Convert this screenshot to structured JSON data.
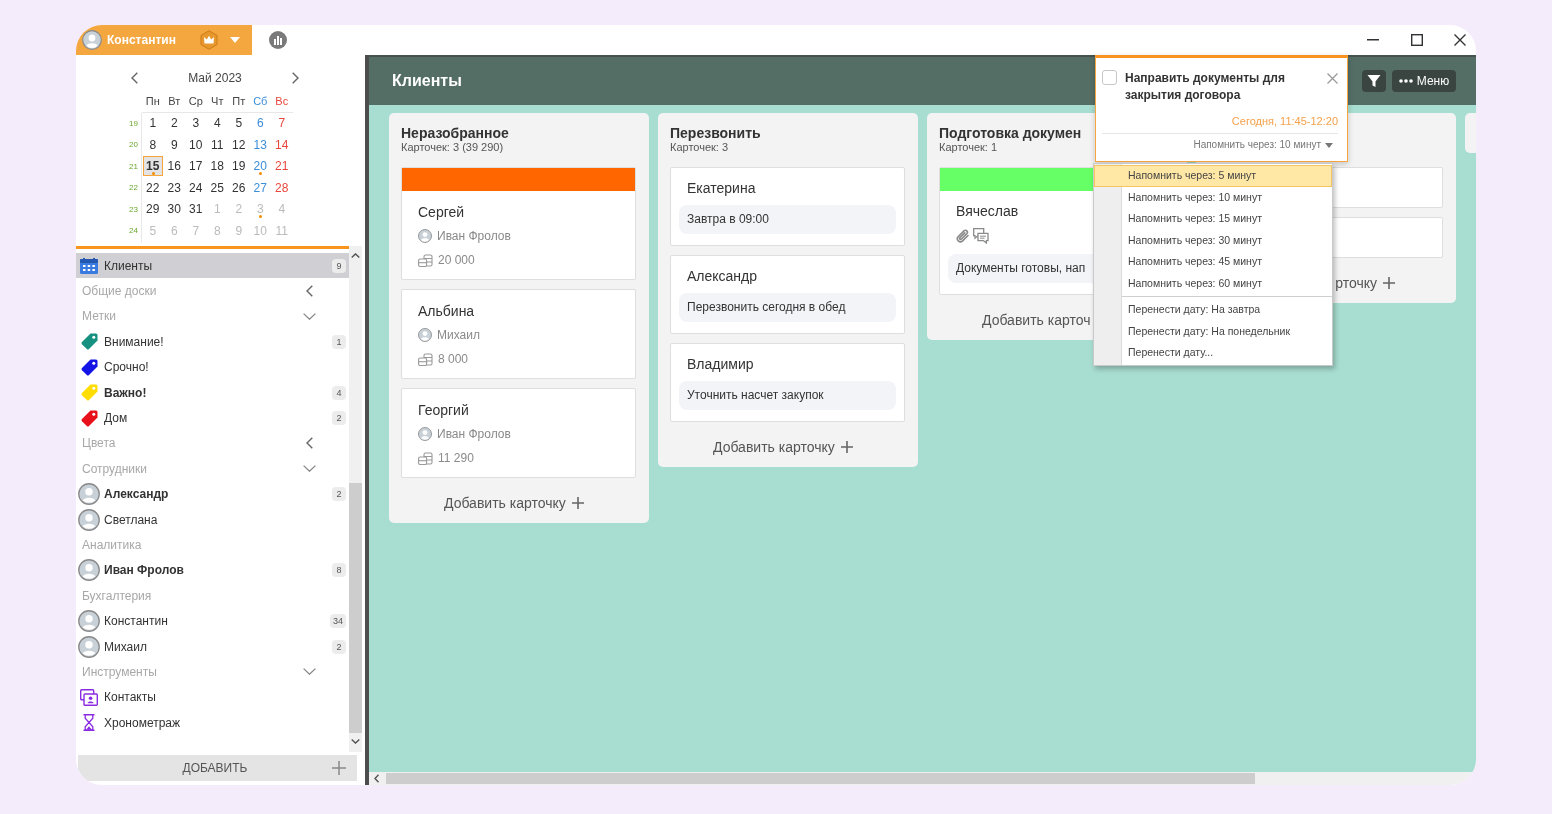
{
  "title_bar": {
    "user": "Константин"
  },
  "calendar": {
    "month": "Май 2023",
    "weekdays": [
      "Пн",
      "Вт",
      "Ср",
      "Чт",
      "Пт",
      "Сб",
      "Вс"
    ],
    "weeks": [
      {
        "number": "19",
        "days": [
          {
            "day": "1",
            "other_month": false,
            "events": false,
            "selected": false
          },
          {
            "day": "2",
            "other_month": false,
            "events": false,
            "selected": false
          },
          {
            "day": "3",
            "other_month": false,
            "events": false,
            "selected": false
          },
          {
            "day": "4",
            "other_month": false,
            "events": false,
            "selected": false
          },
          {
            "day": "5",
            "other_month": false,
            "events": false,
            "selected": false
          },
          {
            "day": "6",
            "other_month": false,
            "events": false,
            "selected": false
          },
          {
            "day": "7",
            "other_month": false,
            "events": false,
            "selected": false
          }
        ]
      },
      {
        "number": "20",
        "days": [
          {
            "day": "8",
            "other_month": false,
            "events": false,
            "selected": false
          },
          {
            "day": "9",
            "other_month": false,
            "events": false,
            "selected": false
          },
          {
            "day": "10",
            "other_month": false,
            "events": false,
            "selected": false
          },
          {
            "day": "11",
            "other_month": false,
            "events": false,
            "selected": false
          },
          {
            "day": "12",
            "other_month": false,
            "events": false,
            "selected": false
          },
          {
            "day": "13",
            "other_month": false,
            "events": false,
            "selected": false
          },
          {
            "day": "14",
            "other_month": false,
            "events": false,
            "selected": false
          }
        ]
      },
      {
        "number": "21",
        "days": [
          {
            "day": "15",
            "other_month": false,
            "events": true,
            "selected": true
          },
          {
            "day": "16",
            "other_month": false,
            "events": false,
            "selected": false
          },
          {
            "day": "17",
            "other_month": false,
            "events": false,
            "selected": false
          },
          {
            "day": "18",
            "other_month": false,
            "events": false,
            "selected": false
          },
          {
            "day": "19",
            "other_month": false,
            "events": false,
            "selected": false
          },
          {
            "day": "20",
            "other_month": false,
            "events": true,
            "selected": false
          },
          {
            "day": "21",
            "other_month": false,
            "events": false,
            "selected": false
          }
        ]
      },
      {
        "number": "22",
        "days": [
          {
            "day": "22",
            "other_month": false,
            "events": false,
            "selected": false
          },
          {
            "day": "23",
            "other_month": false,
            "events": false,
            "selected": false
          },
          {
            "day": "24",
            "other_month": false,
            "events": false,
            "selected": false
          },
          {
            "day": "25",
            "other_month": false,
            "events": false,
            "selected": false
          },
          {
            "day": "26",
            "other_month": false,
            "events": false,
            "selected": false
          },
          {
            "day": "27",
            "other_month": false,
            "events": false,
            "selected": false
          },
          {
            "day": "28",
            "other_month": false,
            "events": false,
            "selected": false
          }
        ]
      },
      {
        "number": "23",
        "days": [
          {
            "day": "29",
            "other_month": false,
            "events": false,
            "selected": false
          },
          {
            "day": "30",
            "other_month": false,
            "events": false,
            "selected": false
          },
          {
            "day": "31",
            "other_month": false,
            "events": false,
            "selected": false
          },
          {
            "day": "1",
            "other_month": true,
            "events": false,
            "selected": false
          },
          {
            "day": "2",
            "other_month": true,
            "events": false,
            "selected": false
          },
          {
            "day": "3",
            "other_month": true,
            "events": true,
            "selected": false
          },
          {
            "day": "4",
            "other_month": true,
            "events": false,
            "selected": false
          }
        ]
      },
      {
        "number": "24",
        "days": [
          {
            "day": "5",
            "other_month": true,
            "events": false,
            "selected": false
          },
          {
            "day": "6",
            "other_month": true,
            "events": false,
            "selected": false
          },
          {
            "day": "7",
            "other_month": true,
            "events": false,
            "selected": false
          },
          {
            "day": "8",
            "other_month": true,
            "events": false,
            "selected": false
          },
          {
            "day": "9",
            "other_month": true,
            "events": false,
            "selected": false
          },
          {
            "day": "10",
            "other_month": true,
            "events": false,
            "selected": false
          },
          {
            "day": "11",
            "other_month": true,
            "events": false,
            "selected": false
          }
        ]
      }
    ]
  },
  "sidebar": {
    "items": [
      {
        "kind": "board",
        "label": "Клиенты",
        "count": "9",
        "selected": true,
        "emphasized": false
      },
      {
        "kind": "section",
        "label": "Общие доски",
        "expanded": false
      },
      {
        "kind": "section",
        "label": "Метки",
        "expanded": true,
        "children": [
          {
            "kind": "tag",
            "label": "Внимание!",
            "color": "#16907f",
            "count": "1",
            "selected": false,
            "emphasized": false
          },
          {
            "kind": "tag",
            "label": "Срочно!",
            "color": "#1414e6",
            "selected": false,
            "emphasized": false
          },
          {
            "kind": "tag",
            "label": "Важно!",
            "color": "#ffdd00",
            "count": "4",
            "selected": false,
            "emphasized": true
          },
          {
            "kind": "tag",
            "label": "Дом",
            "color": "#e8101a",
            "count": "2",
            "selected": false,
            "emphasized": false
          }
        ]
      },
      {
        "kind": "section",
        "label": "Цвета",
        "expanded": false
      },
      {
        "kind": "section",
        "label": "Сотрудники",
        "expanded": true,
        "children": [
          {
            "kind": "person",
            "label": "Александр",
            "count": "2",
            "selected": false,
            "emphasized": true
          },
          {
            "kind": "person",
            "label": "Светлана",
            "selected": false,
            "emphasized": false
          },
          {
            "kind": "group",
            "label": "Аналитика",
            "children": [
              {
                "kind": "person",
                "label": "Иван Фролов",
                "count": "8",
                "selected": false,
                "emphasized": true
              }
            ]
          },
          {
            "kind": "group",
            "label": "Бухгалтерия",
            "children": [
              {
                "kind": "person",
                "label": "Константин",
                "count": "34",
                "selected": false,
                "emphasized": false
              },
              {
                "kind": "person",
                "label": "Михаил",
                "count": "2",
                "selected": false,
                "emphasized": false
              }
            ]
          }
        ]
      },
      {
        "kind": "section",
        "label": "Инструменты",
        "expanded": true,
        "children": [
          {
            "kind": "contacts",
            "label": "Контакты",
            "selected": false,
            "emphasized": false
          },
          {
            "kind": "timer",
            "label": "Хронометраж",
            "selected": false,
            "emphasized": false
          }
        ]
      }
    ],
    "add_label": "ДОБАВИТЬ"
  },
  "board": {
    "title": "Клиенты",
    "menu_label": "Меню",
    "columns": [
      {
        "kind": "full",
        "title": "Неразобранное",
        "subtitle": "Карточек: 3 (39 290)",
        "cards": [
          {
            "kind": "deal",
            "color": "#ff6600",
            "name": "Сергей",
            "assignee": "Иван Фролов",
            "amount": "20 000",
            "attachment": false,
            "comments": false
          },
          {
            "kind": "deal",
            "name": "Альбина",
            "assignee": "Михаил",
            "amount": "8 000",
            "attachment": false,
            "comments": false
          },
          {
            "kind": "deal",
            "name": "Георгий",
            "assignee": "Иван Фролов",
            "amount": "11 290",
            "attachment": false,
            "comments": false
          }
        ],
        "add": {
          "label": "Добавить карточку",
          "plus": true
        }
      },
      {
        "kind": "full",
        "title": "Перезвонить",
        "subtitle": "Карточек: 3",
        "cards": [
          {
            "kind": "task",
            "name": "Екатерина",
            "note": "Завтра в 09:00",
            "attachment": false,
            "comments": false
          },
          {
            "kind": "task",
            "name": "Александр",
            "note": "Перезвонить сегодня в обед",
            "attachment": false,
            "comments": false
          },
          {
            "kind": "task",
            "name": "Владимир",
            "note": "Уточнить насчет закупок",
            "attachment": false,
            "comments": false
          }
        ],
        "add": {
          "label": "Добавить карточку",
          "plus": true
        }
      },
      {
        "kind": "full",
        "title": "Подготовка докумен",
        "subtitle": "Карточек: 1",
        "cards": [
          {
            "kind": "task",
            "color": "#66ff66",
            "name": "Вячеслав",
            "note": "Документы готовы, нап",
            "attachment": true,
            "comments": true
          }
        ],
        "add": {
          "label": "Добавить карточ",
          "plus": false
        }
      },
      {
        "kind": "covered",
        "cards": [
          {
            "kind": "covered"
          },
          {
            "kind": "covered"
          }
        ],
        "add": {
          "label": "рточку",
          "plus": true
        }
      },
      {
        "kind": "edge"
      }
    ]
  },
  "reminder_popup": {
    "checked": false,
    "title": "Направить документы для закрытия договора",
    "time": "Сегодня, 11:45-12:20",
    "reminder": "Напомнить через: 10 минут",
    "menu": {
      "groups": [
        {
          "items": [
            {
              "label": "Напомнить через: 5 минут",
              "selected": true
            },
            {
              "label": "Напомнить через: 10 минут",
              "selected": false
            },
            {
              "label": "Напомнить через: 15 минут",
              "selected": false
            },
            {
              "label": "Напомнить через: 30 минут",
              "selected": false
            },
            {
              "label": "Напомнить через: 45 минут",
              "selected": false
            },
            {
              "label": "Напомнить через: 60 минут",
              "selected": false
            }
          ]
        },
        {
          "items": [
            {
              "label": "Перенести дату: На завтра",
              "selected": false
            },
            {
              "label": "Перенести дату: На понедельник",
              "selected": false
            },
            {
              "label": "Перенести дату...",
              "selected": false
            }
          ]
        }
      ]
    }
  }
}
